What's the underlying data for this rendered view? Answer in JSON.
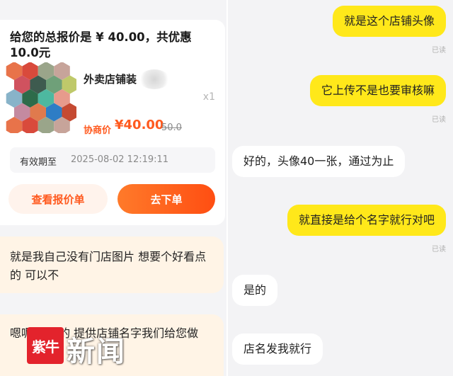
{
  "quote": {
    "title": "给您的总报价是 ¥ 40.00，共优惠 10.0元",
    "product_name": "外卖店铺装",
    "quantity": "x1",
    "price_label": "协商价",
    "price": "¥40.00",
    "original_price": "50.0",
    "validity_label": "有效期至",
    "validity_value": "2025-08-02 12:19:11",
    "view_quote_button": "查看报价单",
    "order_button": "去下单",
    "image_colors": [
      "#e8734a",
      "#d94a3c",
      "#9aa58a",
      "#c7a49a",
      "#d0525f",
      "#3e5b4f",
      "#6fa079",
      "#bfc96a",
      "#88b3c9",
      "#2d6b4a",
      "#4db8a0",
      "#e79b8c",
      "#c48aa0",
      "#e07a4d",
      "#2e7dc5",
      "#c54a32"
    ]
  },
  "left_chat": {
    "message_1": "就是我自己没有门店图片 想要个好看点的 可以不",
    "message_2": "嗯呢 可以的 提供店铺名字我们给您做"
  },
  "watermark": {
    "logo_text": "紫牛",
    "brand_text": "新闻"
  },
  "right_chat": {
    "read_label": "已读",
    "messages": [
      {
        "text": "就是这个店铺头像",
        "from": "me"
      },
      {
        "text": "它上传不是也要审核嘛",
        "from": "me"
      },
      {
        "text": "好的，头像40一张，通过为止",
        "from": "other"
      },
      {
        "text": "就直接是给个名字就行对吧",
        "from": "me"
      },
      {
        "text": "是的",
        "from": "other"
      },
      {
        "text": "店名发我就行",
        "from": "other"
      }
    ]
  },
  "colors": {
    "accent_orange": "#ff5a1f",
    "my_bubble": "#ffe81a",
    "customer_bubble": "#fff4e6"
  }
}
